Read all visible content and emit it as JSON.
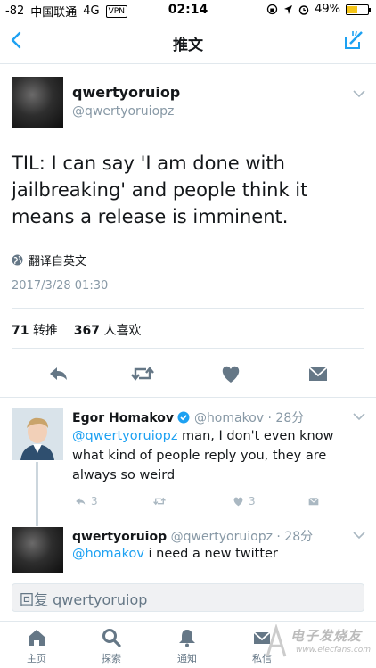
{
  "status_bar": {
    "signal": "-82",
    "carrier": "中国联通",
    "network": "4G",
    "vpn": "VPN",
    "time": "02:14",
    "battery": "49%",
    "battery_level": 0.49
  },
  "nav": {
    "title": "推文",
    "back_icon": "chevron-left-icon",
    "compose_icon": "compose-icon"
  },
  "tweet": {
    "name": "qwertyoruiop",
    "handle": "@qwertyoruiopz",
    "text": "TIL: I can say 'I am done with jailbreaking' and people think it means a release is imminent.",
    "translate_label": "翻译自英文",
    "timestamp": "2017/3/28 01:30",
    "retweet_count": "71",
    "retweet_label": "转推",
    "like_count": "367",
    "like_label": "人喜欢"
  },
  "replies": [
    {
      "name": "Egor Homakov",
      "verified": true,
      "handle": "@homakov",
      "time": "· 28分",
      "mention": "@qwertyoruiopz",
      "text": " man, I don't even know what kind of people reply you, they are always so weird",
      "reply_count": "3",
      "like_count": "3"
    },
    {
      "name": "qwertyoruiop",
      "handle": "@qwertyoruiopz",
      "time": "· 28分",
      "mention": "@homakov",
      "text": " i need a new twitter"
    }
  ],
  "reply_box": {
    "placeholder": "回复 qwertyoruiop"
  },
  "tabs": [
    {
      "label": "主页",
      "icon": "home-icon"
    },
    {
      "label": "探索",
      "icon": "search-icon"
    },
    {
      "label": "通知",
      "icon": "bell-icon"
    },
    {
      "label": "私信",
      "icon": "envelope-icon"
    }
  ],
  "watermark": {
    "text": "电子发烧友",
    "url": "www.elecfans.com"
  },
  "colors": {
    "accent": "#1da1f2",
    "verified": "#1da1f2",
    "muted": "#8899a6",
    "border": "#e1e8ed"
  }
}
